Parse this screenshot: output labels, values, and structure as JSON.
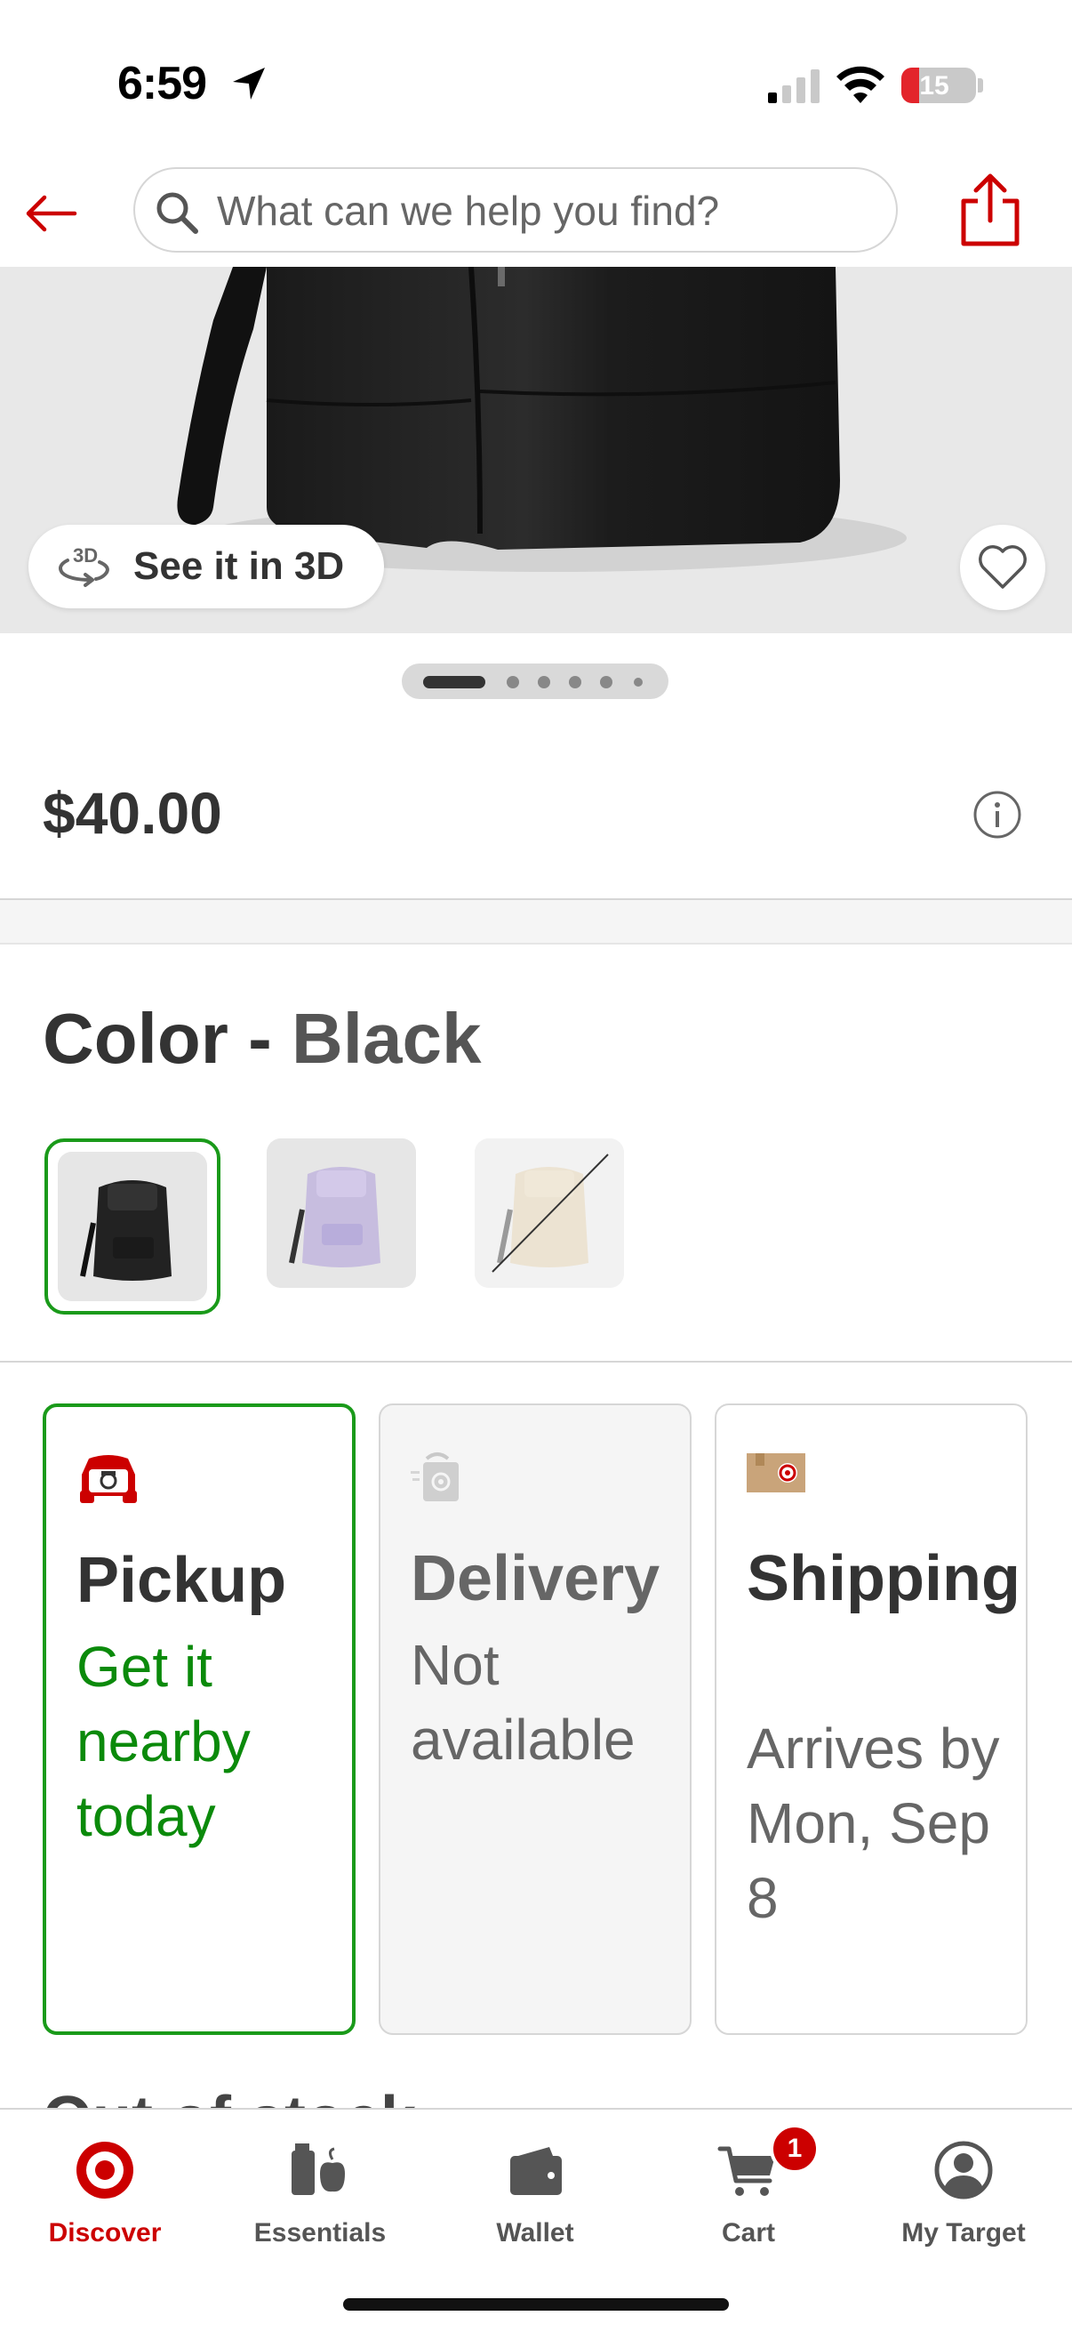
{
  "status_bar": {
    "time": "6:59",
    "battery": "15"
  },
  "header": {
    "search_placeholder": "What can we help you find?"
  },
  "hero": {
    "badge_3d_glyph": "3D",
    "badge_3d_label": "See it in 3D",
    "carousel_dots": 6,
    "active_dot": 0
  },
  "product": {
    "price": "$40.00"
  },
  "color": {
    "label": "Color",
    "separator": " - ",
    "selected": "Black",
    "swatches": [
      "Black",
      "Lavender",
      "Cream"
    ]
  },
  "fulfillment": {
    "pickup": {
      "title": "Pickup",
      "subtitle": "Get it nearby today"
    },
    "delivery": {
      "title": "Delivery",
      "subtitle": "Not available"
    },
    "shipping": {
      "title": "Shipping",
      "subtitle": "Arrives by Mon, Sep 8"
    }
  },
  "stock": {
    "label": "Out of stock"
  },
  "tabbar": {
    "items": [
      {
        "label": "Discover",
        "icon": "target-bullseye-icon"
      },
      {
        "label": "Essentials",
        "icon": "essentials-icon"
      },
      {
        "label": "Wallet",
        "icon": "wallet-icon"
      },
      {
        "label": "Cart",
        "icon": "cart-icon",
        "badge": "1"
      },
      {
        "label": "My Target",
        "icon": "account-icon"
      }
    ]
  },
  "colors": {
    "brand_red": "#cc0000",
    "success_green": "#0b8a0b"
  }
}
